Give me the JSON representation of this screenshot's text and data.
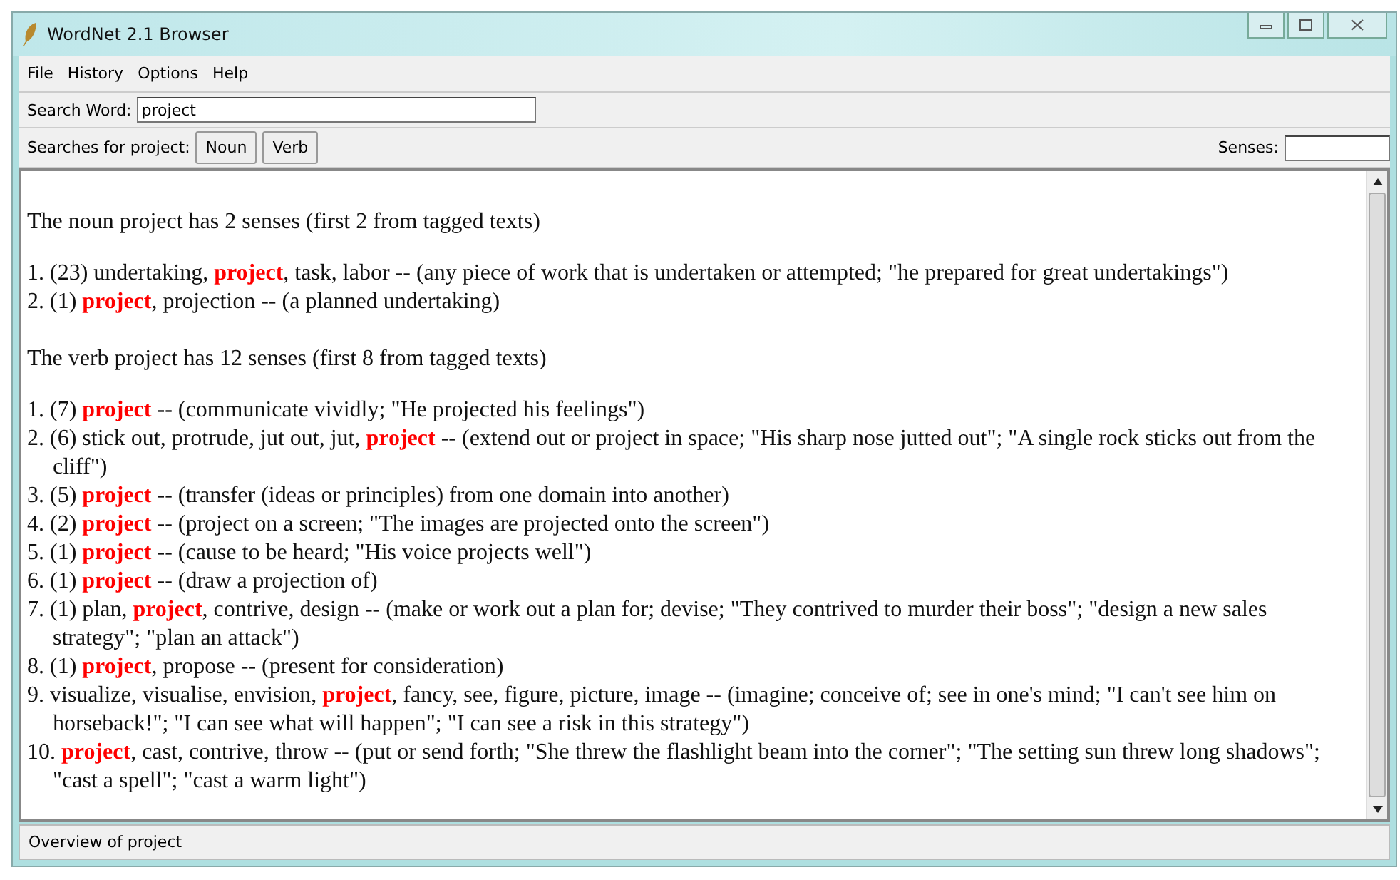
{
  "window": {
    "title": "WordNet 2.1 Browser"
  },
  "menu": [
    "File",
    "History",
    "Options",
    "Help"
  ],
  "search": {
    "label": "Search Word:",
    "value": "project"
  },
  "searches": {
    "label": "Searches for project:",
    "buttons": [
      "Noun",
      "Verb"
    ],
    "senses_label": "Senses:"
  },
  "results": [
    {
      "heading": "The noun project has 2 senses (first 2 from tagged texts)",
      "senses": [
        "1. (23) undertaking, **project**, task, labor -- (any piece of work that is undertaken or attempted; \"he prepared for great undertakings\")",
        "2. (1) **project**, projection -- (a planned undertaking)"
      ]
    },
    {
      "heading": "The verb project has 12 senses (first 8 from tagged texts)",
      "senses": [
        "1. (7) **project** -- (communicate vividly; \"He projected his feelings\")",
        "2. (6) stick out, protrude, jut out, jut, **project** -- (extend out or project in space; \"His sharp nose jutted out\"; \"A single rock sticks out from the cliff\")",
        "3. (5) **project** -- (transfer (ideas or principles) from one domain into another)",
        "4. (2) **project** -- (project on a screen; \"The images are projected onto the screen\")",
        "5. (1) **project** -- (cause to be heard; \"His voice projects well\")",
        "6. (1) **project** -- (draw a projection of)",
        "7. (1) plan, **project**, contrive, design -- (make or work out a plan for; devise; \"They contrived to murder their boss\"; \"design a new sales strategy\"; \"plan an attack\")",
        "8. (1) **project**, propose -- (present for consideration)",
        "9. visualize, visualise, envision, **project**, fancy, see, figure, picture, image -- (imagine; conceive of; see in one's mind; \"I can't see him on horseback!\"; \"I can see what will happen\"; \"I can see a risk in this strategy\")",
        "10. **project**, cast, contrive, throw -- (put or send forth; \"She threw the flashlight beam into the corner\"; \"The setting sun threw long shadows\"; \"cast a spell\"; \"cast a warm light\")"
      ]
    }
  ],
  "status_bar": "Overview of project"
}
